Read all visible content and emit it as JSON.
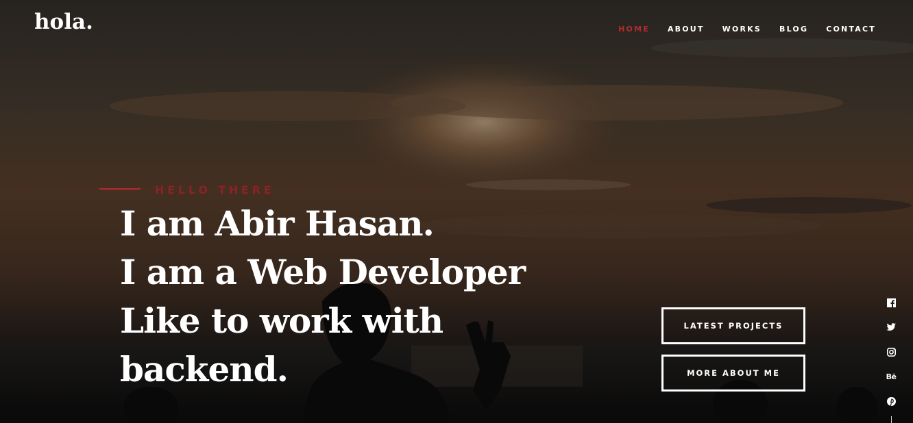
{
  "brand": {
    "logo_text": "hola."
  },
  "nav": {
    "items": [
      {
        "label": "HOME",
        "active": true
      },
      {
        "label": "ABOUT",
        "active": false
      },
      {
        "label": "WORKS",
        "active": false
      },
      {
        "label": "BLOG",
        "active": false
      },
      {
        "label": "CONTACT",
        "active": false
      }
    ]
  },
  "hero": {
    "eyebrow": "HELLO THERE",
    "headline_lines": [
      "I am Abir Hasan.",
      "I am a Web Developer",
      "Like to work with",
      "backend."
    ],
    "buttons": {
      "primary_label": "LATEST PROJECTS",
      "secondary_label": "MORE ABOUT ME"
    }
  },
  "social": {
    "icons": [
      "facebook-icon",
      "twitter-icon",
      "instagram-icon",
      "behance-icon",
      "pinterest-icon"
    ],
    "behance_text": "Bē"
  },
  "colors": {
    "accent": "#b52b2f",
    "text": "#ffffff",
    "overlay_dark": "#1a1512"
  }
}
